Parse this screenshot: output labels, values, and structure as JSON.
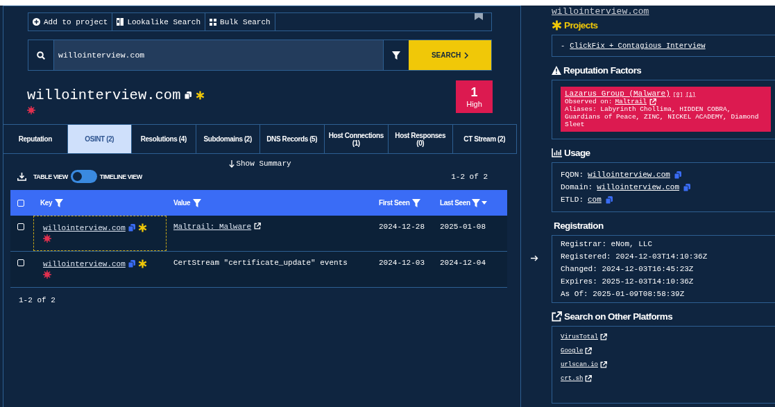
{
  "toolbar": [
    {
      "label": "Add to project"
    },
    {
      "label": "Lookalike Search"
    },
    {
      "label": "Bulk Search"
    }
  ],
  "search": {
    "value": "willointerview.com",
    "button": "SEARCH"
  },
  "title": "willointerview.com",
  "risk": {
    "score": "1",
    "label": "High"
  },
  "tabs": [
    {
      "label": "Reputation",
      "selected": false
    },
    {
      "label": "OSINT (2)",
      "selected": true
    },
    {
      "label": "Resolutions (4)",
      "selected": false
    },
    {
      "label": "Subdomains (2)",
      "selected": false
    },
    {
      "label": "DNS Records (5)",
      "selected": false
    },
    {
      "label": "Host Connections (1)",
      "selected": false
    },
    {
      "label": "Host Responses (0)",
      "selected": false
    },
    {
      "label": "CT Stream (2)",
      "selected": false
    }
  ],
  "show_summary": "Show Summary",
  "view_toggle": {
    "left": "TABLE VIEW",
    "right": "TIMELINE VIEW",
    "timeline": false
  },
  "pagination_top": "1-2 of 2",
  "table": {
    "header_checked": false,
    "columns": [
      {
        "label": "Key",
        "sorted": false
      },
      {
        "label": "Value",
        "sorted": false
      },
      {
        "label": "First Seen",
        "sorted": false
      },
      {
        "label": "Last Seen",
        "sorted": true
      }
    ],
    "rows": [
      {
        "checked": false,
        "focused": true,
        "key": "willointerview.com",
        "value": "Maltrail: Malware",
        "kind": "link",
        "first_seen": "2024-12-28",
        "last_seen": "2025-01-08"
      },
      {
        "checked": false,
        "focused": false,
        "key": "willointerview.com",
        "value": "CertStream \"certificate_update\" events",
        "kind": "text",
        "first_seen": "2024-12-03",
        "last_seen": "2024-12-04"
      }
    ]
  },
  "pagination_bottom": "1-2 of 2",
  "side": {
    "top_link": "willointerview.com",
    "projects": {
      "title": "Projects",
      "items": [
        {
          "bullet": "-",
          "label": "ClickFix + Contagious Interview"
        }
      ]
    },
    "reputation": {
      "title": "Reputation Factors",
      "factors": [
        {
          "name": "Lazarus Group (Malware)",
          "refs": [
            "[0]",
            "[1]"
          ],
          "observed_label": "Observed on:",
          "observed_source": "Maltrail",
          "aliases": "Aliases: Labyrinth Chollima, HIDDEN COBRA, Guardians of Peace, ZINC, NICKEL ACADEMY, Diamond Sleet"
        }
      ]
    },
    "usage": {
      "title": "Usage",
      "items": [
        {
          "label": "FQDN:",
          "value": "willointerview.com"
        },
        {
          "label": "Domain:",
          "value": "willointerview.com"
        },
        {
          "label": "ETLD:",
          "value": "com"
        }
      ]
    },
    "registration": {
      "title": "Registration",
      "lines": [
        "Registrar: eNom, LLC",
        "Registered: 2024-12-03T14:10:36Z",
        "Changed: 2024-12-03T16:45:23Z",
        "Expires: 2025-12-03T14:10:36Z",
        "As Of: 2025-01-09T08:58:39Z"
      ]
    },
    "platforms": {
      "title": "Search on Other Platforms",
      "links": [
        "VirusTotal",
        "Google",
        "urlscan.io",
        "crt.sh"
      ]
    }
  }
}
